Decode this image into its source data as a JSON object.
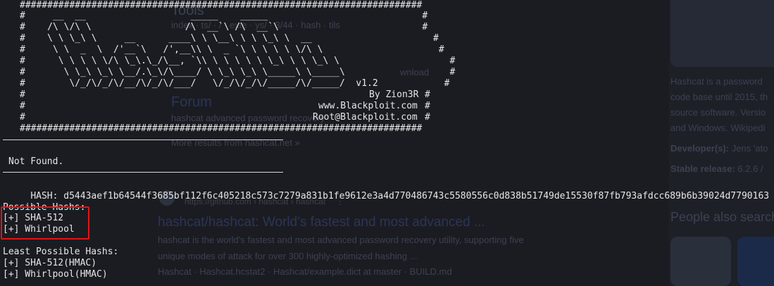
{
  "background_page": {
    "tools_heading": "Tools",
    "tools_breadcrumb": "index · ts/ · / · exte · ys/ · 3/44 · hash · tils",
    "forum_heading": "Forum",
    "forum_snippet": "hashcat advanced password recovery",
    "more_results": "More results from hashcat.net »",
    "downloads_fragment": "wnload",
    "github_url": "https://github.com › hashcat › hashcat",
    "github_menu": "⋮",
    "result_title": "hashcat/hashcat: World's fastest and most advanced ...",
    "result_snippet_line1": "hashcat is the world's fastest and most advanced password recovery utility, supporting five",
    "result_snippet_line2": "unique modes of attack for over 300 highly-optimized hashing ...",
    "result_links": "Hashcat · Hashcat.hcstat2 · Hashcat/example.dict at master · BUILD.md",
    "panel_desc_1": "Hashcat is a password",
    "panel_desc_2": "code base until 2015, th",
    "panel_desc_3": "source software. Versio",
    "panel_desc_4": "and Windows. Wikipedi",
    "panel_developer_label": "Developer(s):",
    "panel_developer_value": "Jens 'ato",
    "panel_stable_label": "Stable release:",
    "panel_stable_value": "6.2.6 /",
    "people_also_search": "People also search"
  },
  "banner": {
    "border": "#########################################################################",
    "art": [
      "#     __  __                   _____    _____                            #",
      "#    /\\ \\/\\ \\                 /\\  __`\\ /\\  __`\\                          #",
      "#    \\ \\ \\_\\ \\     __      ____\\ \\ \\__\\ \\ \\ \\_\\ \\  __                      #",
      "#     \\ \\  _  \\  /'__`\\   /',__\\\\ \\  _ `\\ \\ \\ \\ \\ \\/\\ \\                     #",
      "#      \\ \\ \\ \\ \\/\\ \\_\\.\\_/\\__, `\\\\ \\ \\ \\ \\ \\ \\_\\ \\ \\ \\_\\ \\                    #",
      "#       \\ \\_\\ \\_\\ \\__/.\\_\\/\\____/ \\ \\_\\ \\_\\ \\_____\\ \\_____\\                   #",
      "#        \\/_/\\/_/\\/__/\\/_/\\/___/   \\/_/\\/_/\\/_____/\\/_____/  v1.2            #"
    ],
    "version": "v1.2",
    "author": "By Zion3R",
    "site": "www.Blackploit.com",
    "email": "Root@Blackploit.com"
  },
  "output": {
    "not_found": "Not Found.",
    "hash_label": "HASH:",
    "hash_value": "d5443aef1b64544f3685bf112f6c405218c573c7279a831b1fe9612e3a4d770486743c5580556c0d838b51749de15530f87fb793afdcc689b6b39024d7790163",
    "possible_heading": "Possible Hashs:",
    "possible": [
      "[+] SHA-512",
      "[+] Whirlpool"
    ],
    "least_heading": "Least Possible Hashs:",
    "least": [
      "[+] SHA-512(HMAC)",
      "[+] Whirlpool(HMAC)"
    ]
  },
  "colors": {
    "terminal_bg": "#1b1c22",
    "terminal_text": "#e6e6e6",
    "highlight_box": "#e01515"
  }
}
